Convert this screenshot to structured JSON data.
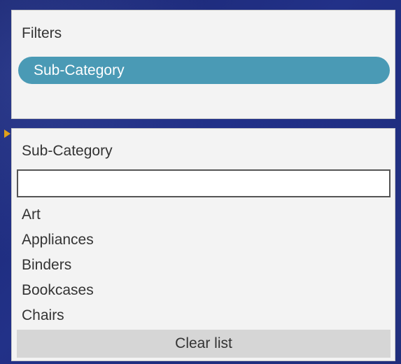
{
  "filters_panel": {
    "title": "Filters",
    "pill": {
      "label": "Sub-Category",
      "color": "#4a9ab5"
    }
  },
  "quick_filter": {
    "title": "Sub-Category",
    "search": {
      "value": "",
      "placeholder": ""
    },
    "items": [
      {
        "label": "Art"
      },
      {
        "label": "Appliances"
      },
      {
        "label": "Binders"
      },
      {
        "label": "Bookcases"
      },
      {
        "label": "Chairs"
      }
    ],
    "clear_button_label": "Clear list"
  },
  "indicator": {
    "icon": "pointer-arrow-icon",
    "color": "#e0a11b"
  }
}
